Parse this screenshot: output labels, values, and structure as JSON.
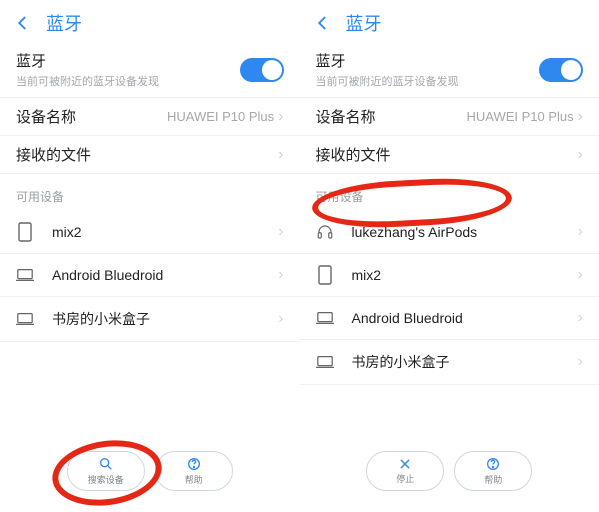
{
  "colors": {
    "accent": "#2f88f0",
    "annotation": "#e52815"
  },
  "left": {
    "header": {
      "title": "蓝牙"
    },
    "bt_label": "蓝牙",
    "bt_sub": "当前可被附近的蓝牙设备发现",
    "device_name_label": "设备名称",
    "device_name_value": "HUAWEI P10 Plus",
    "received_files_label": "接收的文件",
    "available_header": "可用设备",
    "devices": [
      {
        "name": "mix2",
        "icon": "phone"
      },
      {
        "name": "Android Bluedroid",
        "icon": "laptop"
      },
      {
        "name": "书房的小米盒子",
        "icon": "laptop"
      }
    ],
    "footer": {
      "search_label": "搜索设备",
      "help_label": "帮助"
    }
  },
  "right": {
    "header": {
      "title": "蓝牙"
    },
    "bt_label": "蓝牙",
    "bt_sub": "当前可被附近的蓝牙设备发现",
    "device_name_label": "设备名称",
    "device_name_value": "HUAWEI P10 Plus",
    "received_files_label": "接收的文件",
    "available_header": "可用设备",
    "devices": [
      {
        "name": "lukezhang's AirPods",
        "icon": "headphones"
      },
      {
        "name": "mix2",
        "icon": "phone"
      },
      {
        "name": "Android Bluedroid",
        "icon": "laptop"
      },
      {
        "name": "书房的小米盒子",
        "icon": "laptop"
      }
    ],
    "footer": {
      "stop_label": "停止",
      "help_label": "帮助"
    }
  }
}
